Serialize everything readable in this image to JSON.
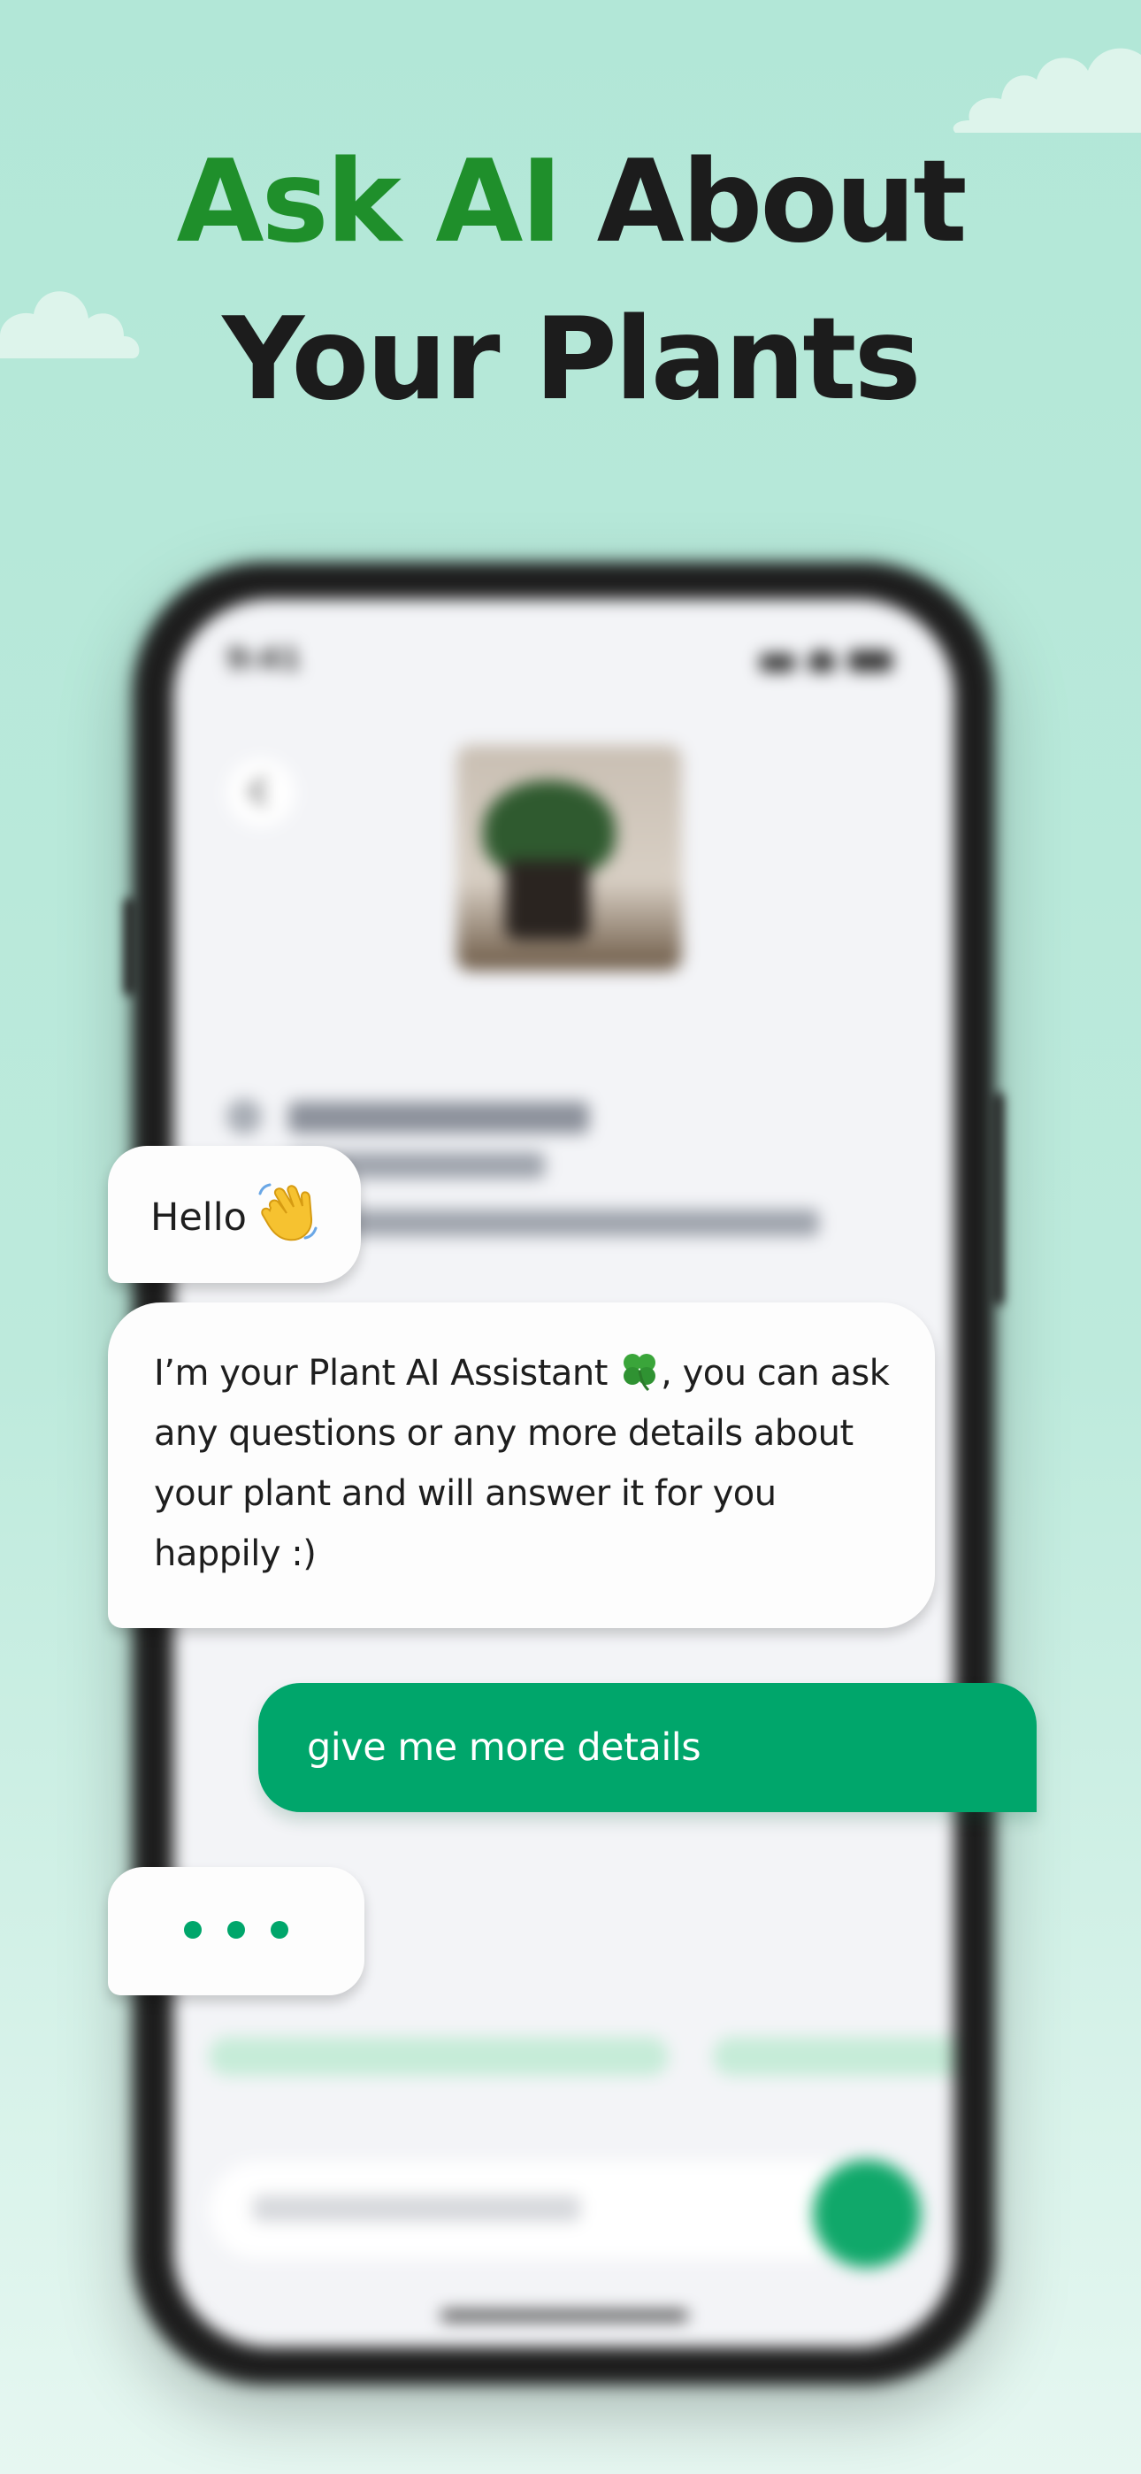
{
  "headline": {
    "accent_text": "Ask AI",
    "line1_rest": " About",
    "line2": "Your Plants"
  },
  "phone": {
    "status_time": "9:41"
  },
  "chat": {
    "greeting": "Hello",
    "greeting_emoji": "waving-hand-icon",
    "assistant_message_part1": "I’m your Plant AI  Assistant ",
    "assistant_message_emoji": "four-leaf-clover-icon",
    "assistant_message_part2": ", you can ask any questions or any more details about your plant and will answer it for you happily :)",
    "user_message": "give me more details",
    "typing_indicator": "typing-dots"
  },
  "colors": {
    "accent_green": "#1f8f2b",
    "bubble_green": "#00a66b",
    "background": "#b2e7d7",
    "headline_dark": "#1c1c1c"
  }
}
